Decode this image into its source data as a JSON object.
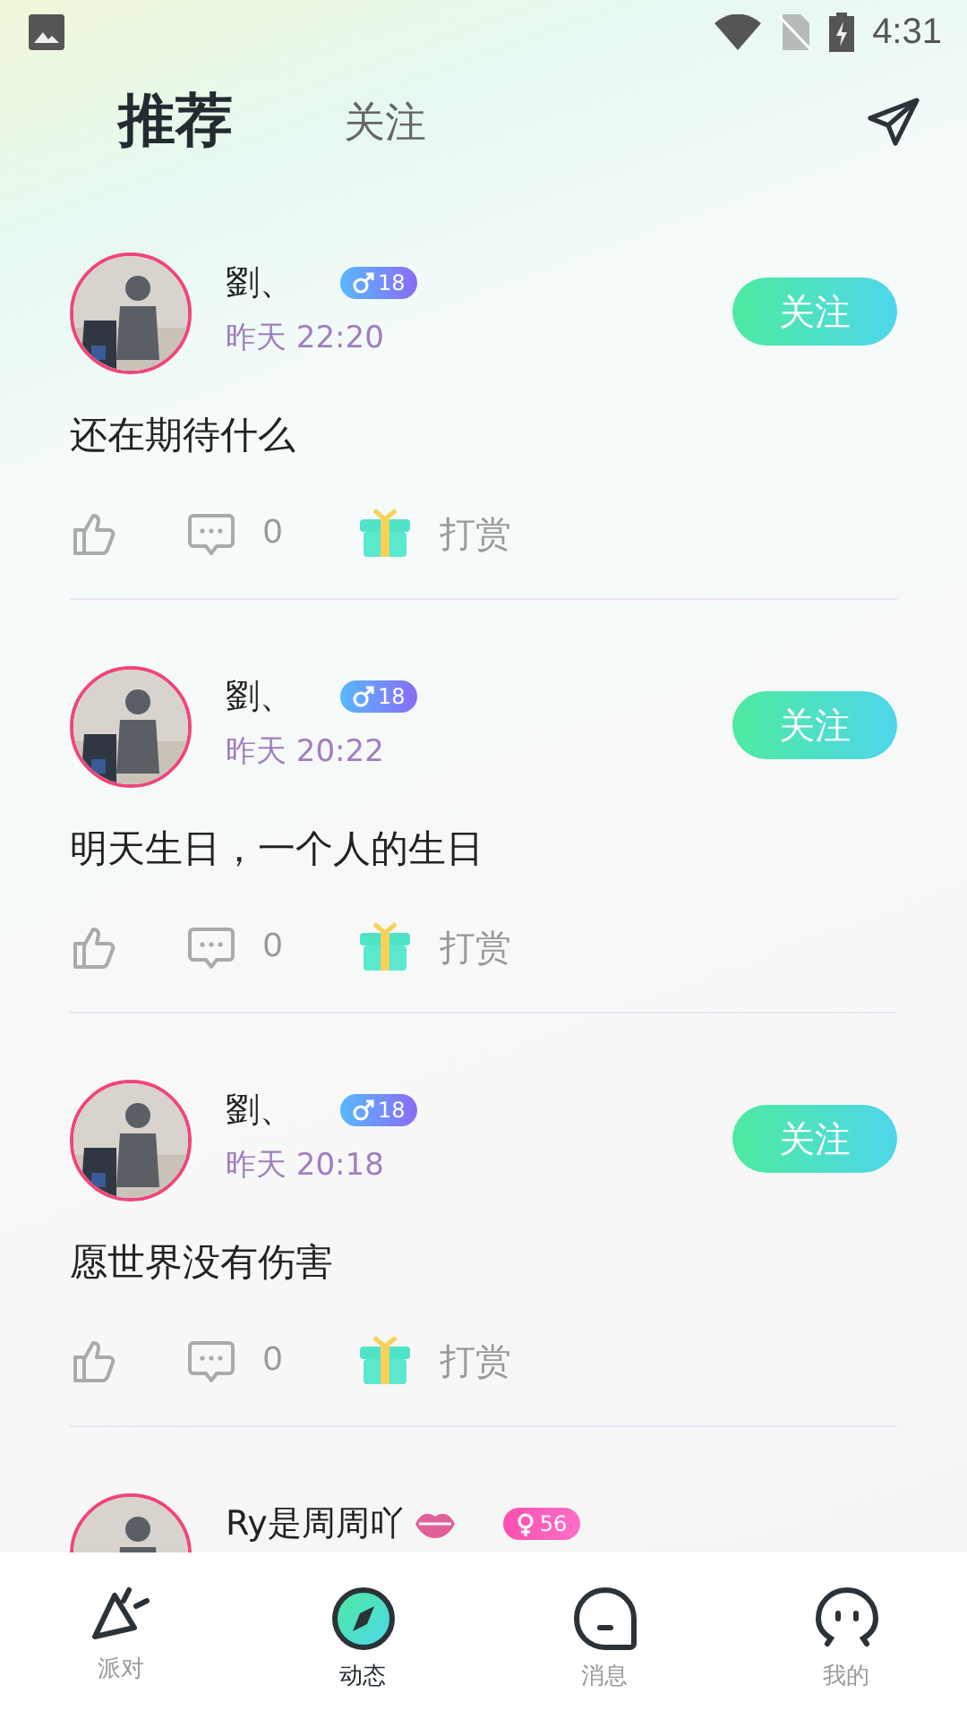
{
  "status_bar": {
    "time": "4:31"
  },
  "tabs": [
    {
      "label": "推荐",
      "selected": true
    },
    {
      "label": "关注",
      "selected": false
    }
  ],
  "posts": [
    {
      "name": "劉、",
      "kind": "male",
      "age": "18",
      "time": "昨天 22:20",
      "follow": "关注",
      "text": "还在期待什么",
      "comments": "0",
      "reward": "打赏"
    },
    {
      "name": "劉、",
      "kind": "male",
      "age": "18",
      "time": "昨天 20:22",
      "follow": "关注",
      "text": "明天生日，一个人的生日",
      "comments": "0",
      "reward": "打赏"
    },
    {
      "name": "劉、",
      "kind": "male",
      "age": "18",
      "time": "昨天 20:18",
      "follow": "关注",
      "text": "愿世界没有伤害",
      "comments": "0",
      "reward": "打赏"
    },
    {
      "name": "Ry是周周吖",
      "kind": "female",
      "age": "56",
      "lips": true
    }
  ],
  "nav": [
    {
      "label": "派对",
      "kind": "party",
      "selected": false
    },
    {
      "label": "动态",
      "kind": "compass",
      "selected": true
    },
    {
      "label": "消息",
      "kind": "message",
      "selected": false
    },
    {
      "label": "我的",
      "kind": "me",
      "selected": false
    }
  ]
}
